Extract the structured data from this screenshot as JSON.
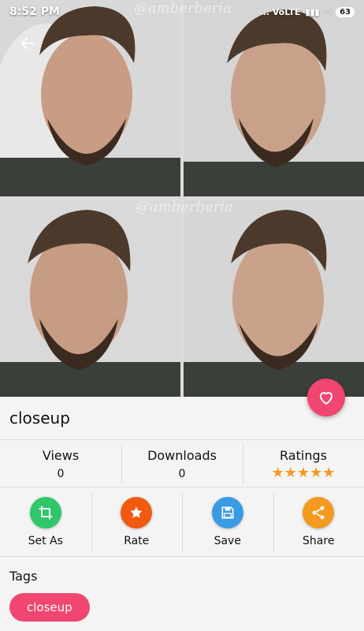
{
  "status_bar": {
    "time": "8:52 PM",
    "indicators": "... VoLTE",
    "battery": "63"
  },
  "hero": {
    "watermark": "@amberberia"
  },
  "wallpaper": {
    "title": "closeup"
  },
  "stats": {
    "views_label": "Views",
    "views_value": "0",
    "downloads_label": "Downloads",
    "downloads_value": "0",
    "ratings_label": "Ratings",
    "rating_stars": "★★★★★",
    "rating_value": 5
  },
  "actions": [
    {
      "label": "Set As",
      "icon": "crop-icon",
      "color": "#2fc76a"
    },
    {
      "label": "Rate",
      "icon": "star-icon",
      "color": "#f25a11"
    },
    {
      "label": "Save",
      "icon": "floppy-icon",
      "color": "#3a9be4"
    },
    {
      "label": "Share",
      "icon": "share-icon",
      "color": "#f39a1f"
    }
  ],
  "tags": {
    "title": "Tags",
    "items": [
      "closeup"
    ]
  },
  "colors": {
    "accent": "#f0466f",
    "star": "#f39a1f"
  }
}
